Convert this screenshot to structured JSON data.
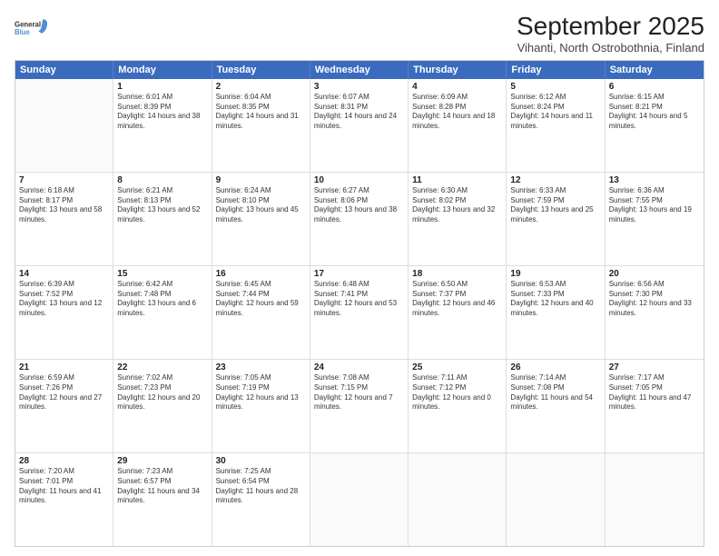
{
  "logo": {
    "line1": "General",
    "line2": "Blue"
  },
  "title": "September 2025",
  "subtitle": "Vihanti, North Ostrobothnia, Finland",
  "header_days": [
    "Sunday",
    "Monday",
    "Tuesday",
    "Wednesday",
    "Thursday",
    "Friday",
    "Saturday"
  ],
  "weeks": [
    [
      {
        "day": "",
        "sunrise": "",
        "sunset": "",
        "daylight": ""
      },
      {
        "day": "1",
        "sunrise": "Sunrise: 6:01 AM",
        "sunset": "Sunset: 8:39 PM",
        "daylight": "Daylight: 14 hours and 38 minutes."
      },
      {
        "day": "2",
        "sunrise": "Sunrise: 6:04 AM",
        "sunset": "Sunset: 8:35 PM",
        "daylight": "Daylight: 14 hours and 31 minutes."
      },
      {
        "day": "3",
        "sunrise": "Sunrise: 6:07 AM",
        "sunset": "Sunset: 8:31 PM",
        "daylight": "Daylight: 14 hours and 24 minutes."
      },
      {
        "day": "4",
        "sunrise": "Sunrise: 6:09 AM",
        "sunset": "Sunset: 8:28 PM",
        "daylight": "Daylight: 14 hours and 18 minutes."
      },
      {
        "day": "5",
        "sunrise": "Sunrise: 6:12 AM",
        "sunset": "Sunset: 8:24 PM",
        "daylight": "Daylight: 14 hours and 11 minutes."
      },
      {
        "day": "6",
        "sunrise": "Sunrise: 6:15 AM",
        "sunset": "Sunset: 8:21 PM",
        "daylight": "Daylight: 14 hours and 5 minutes."
      }
    ],
    [
      {
        "day": "7",
        "sunrise": "Sunrise: 6:18 AM",
        "sunset": "Sunset: 8:17 PM",
        "daylight": "Daylight: 13 hours and 58 minutes."
      },
      {
        "day": "8",
        "sunrise": "Sunrise: 6:21 AM",
        "sunset": "Sunset: 8:13 PM",
        "daylight": "Daylight: 13 hours and 52 minutes."
      },
      {
        "day": "9",
        "sunrise": "Sunrise: 6:24 AM",
        "sunset": "Sunset: 8:10 PM",
        "daylight": "Daylight: 13 hours and 45 minutes."
      },
      {
        "day": "10",
        "sunrise": "Sunrise: 6:27 AM",
        "sunset": "Sunset: 8:06 PM",
        "daylight": "Daylight: 13 hours and 38 minutes."
      },
      {
        "day": "11",
        "sunrise": "Sunrise: 6:30 AM",
        "sunset": "Sunset: 8:02 PM",
        "daylight": "Daylight: 13 hours and 32 minutes."
      },
      {
        "day": "12",
        "sunrise": "Sunrise: 6:33 AM",
        "sunset": "Sunset: 7:59 PM",
        "daylight": "Daylight: 13 hours and 25 minutes."
      },
      {
        "day": "13",
        "sunrise": "Sunrise: 6:36 AM",
        "sunset": "Sunset: 7:55 PM",
        "daylight": "Daylight: 13 hours and 19 minutes."
      }
    ],
    [
      {
        "day": "14",
        "sunrise": "Sunrise: 6:39 AM",
        "sunset": "Sunset: 7:52 PM",
        "daylight": "Daylight: 13 hours and 12 minutes."
      },
      {
        "day": "15",
        "sunrise": "Sunrise: 6:42 AM",
        "sunset": "Sunset: 7:48 PM",
        "daylight": "Daylight: 13 hours and 6 minutes."
      },
      {
        "day": "16",
        "sunrise": "Sunrise: 6:45 AM",
        "sunset": "Sunset: 7:44 PM",
        "daylight": "Daylight: 12 hours and 59 minutes."
      },
      {
        "day": "17",
        "sunrise": "Sunrise: 6:48 AM",
        "sunset": "Sunset: 7:41 PM",
        "daylight": "Daylight: 12 hours and 53 minutes."
      },
      {
        "day": "18",
        "sunrise": "Sunrise: 6:50 AM",
        "sunset": "Sunset: 7:37 PM",
        "daylight": "Daylight: 12 hours and 46 minutes."
      },
      {
        "day": "19",
        "sunrise": "Sunrise: 6:53 AM",
        "sunset": "Sunset: 7:33 PM",
        "daylight": "Daylight: 12 hours and 40 minutes."
      },
      {
        "day": "20",
        "sunrise": "Sunrise: 6:56 AM",
        "sunset": "Sunset: 7:30 PM",
        "daylight": "Daylight: 12 hours and 33 minutes."
      }
    ],
    [
      {
        "day": "21",
        "sunrise": "Sunrise: 6:59 AM",
        "sunset": "Sunset: 7:26 PM",
        "daylight": "Daylight: 12 hours and 27 minutes."
      },
      {
        "day": "22",
        "sunrise": "Sunrise: 7:02 AM",
        "sunset": "Sunset: 7:23 PM",
        "daylight": "Daylight: 12 hours and 20 minutes."
      },
      {
        "day": "23",
        "sunrise": "Sunrise: 7:05 AM",
        "sunset": "Sunset: 7:19 PM",
        "daylight": "Daylight: 12 hours and 13 minutes."
      },
      {
        "day": "24",
        "sunrise": "Sunrise: 7:08 AM",
        "sunset": "Sunset: 7:15 PM",
        "daylight": "Daylight: 12 hours and 7 minutes."
      },
      {
        "day": "25",
        "sunrise": "Sunrise: 7:11 AM",
        "sunset": "Sunset: 7:12 PM",
        "daylight": "Daylight: 12 hours and 0 minutes."
      },
      {
        "day": "26",
        "sunrise": "Sunrise: 7:14 AM",
        "sunset": "Sunset: 7:08 PM",
        "daylight": "Daylight: 11 hours and 54 minutes."
      },
      {
        "day": "27",
        "sunrise": "Sunrise: 7:17 AM",
        "sunset": "Sunset: 7:05 PM",
        "daylight": "Daylight: 11 hours and 47 minutes."
      }
    ],
    [
      {
        "day": "28",
        "sunrise": "Sunrise: 7:20 AM",
        "sunset": "Sunset: 7:01 PM",
        "daylight": "Daylight: 11 hours and 41 minutes."
      },
      {
        "day": "29",
        "sunrise": "Sunrise: 7:23 AM",
        "sunset": "Sunset: 6:57 PM",
        "daylight": "Daylight: 11 hours and 34 minutes."
      },
      {
        "day": "30",
        "sunrise": "Sunrise: 7:25 AM",
        "sunset": "Sunset: 6:54 PM",
        "daylight": "Daylight: 11 hours and 28 minutes."
      },
      {
        "day": "",
        "sunrise": "",
        "sunset": "",
        "daylight": ""
      },
      {
        "day": "",
        "sunrise": "",
        "sunset": "",
        "daylight": ""
      },
      {
        "day": "",
        "sunrise": "",
        "sunset": "",
        "daylight": ""
      },
      {
        "day": "",
        "sunrise": "",
        "sunset": "",
        "daylight": ""
      }
    ]
  ]
}
